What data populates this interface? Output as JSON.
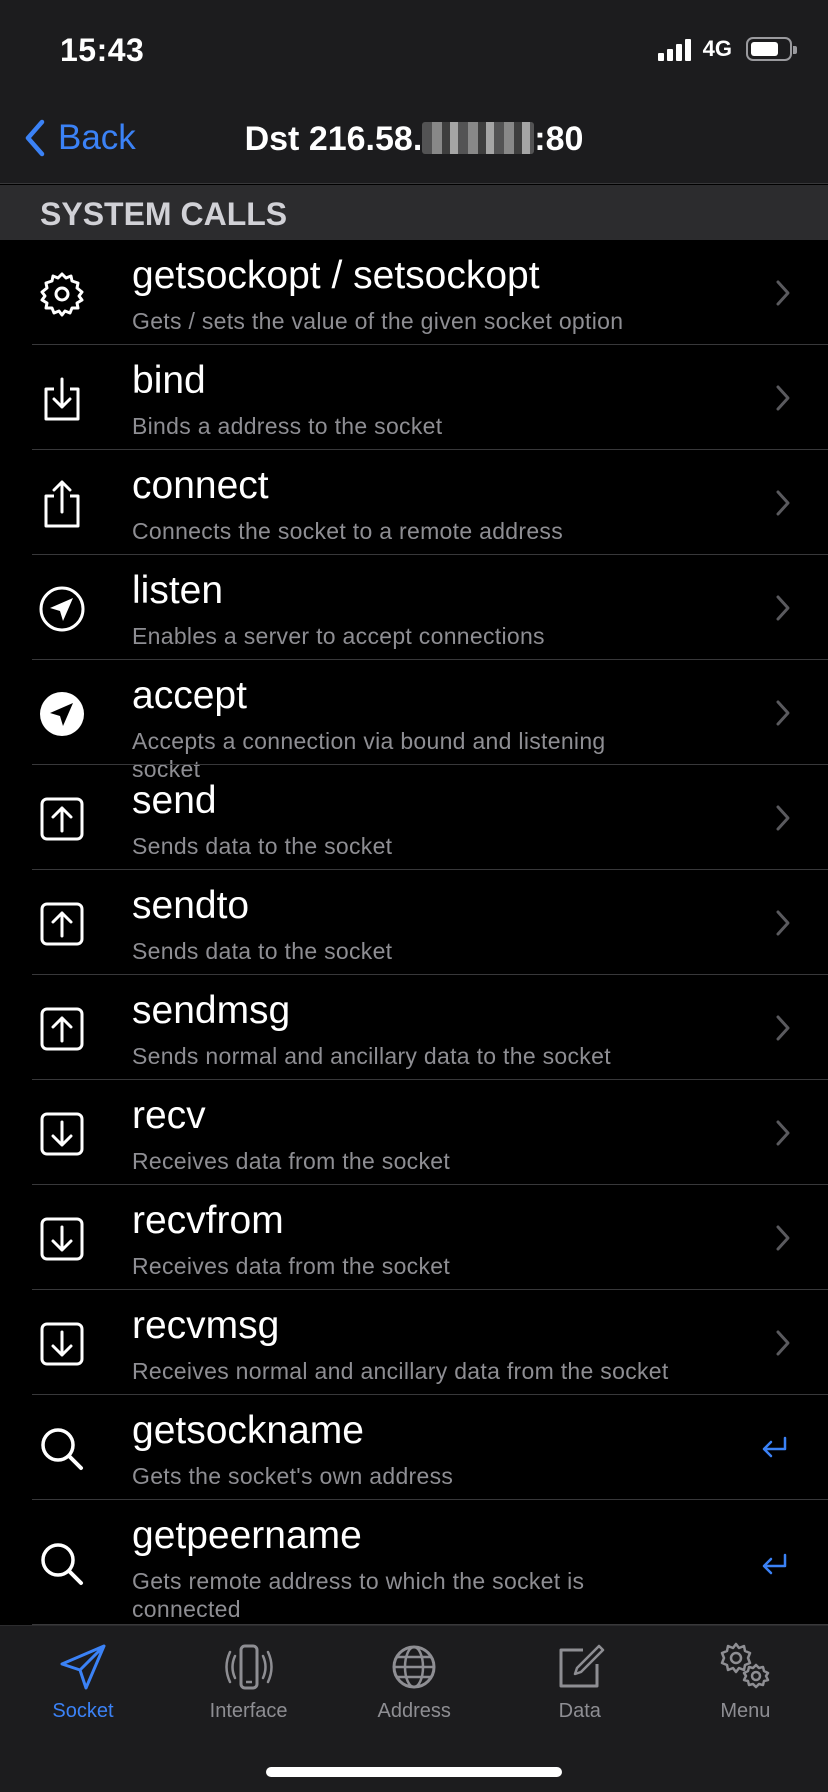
{
  "status": {
    "time": "15:43",
    "network": "4G",
    "battery_level": 0.7
  },
  "nav": {
    "back_label": "Back",
    "title_prefix": "Dst 216.58.",
    "title_suffix": ":80"
  },
  "section": {
    "title": "SYSTEM CALLS"
  },
  "calls": [
    {
      "name": "getsockopt / setsockopt",
      "desc": "Gets / sets the value of the given socket option",
      "icon": "gear-icon",
      "accessory": "chevron"
    },
    {
      "name": "bind",
      "desc": "Binds a address to the socket",
      "icon": "tray-arrow-down-icon",
      "accessory": "chevron"
    },
    {
      "name": "connect",
      "desc": "Connects the socket to a remote address",
      "icon": "share-icon",
      "accessory": "chevron"
    },
    {
      "name": "listen",
      "desc": "Enables a server to accept connections",
      "icon": "location-circle-outline-icon",
      "accessory": "chevron"
    },
    {
      "name": "accept",
      "desc": "Accepts a connection via bound and listening socket",
      "icon": "location-circle-fill-icon",
      "accessory": "chevron"
    },
    {
      "name": "send",
      "desc": "Sends data to the socket",
      "icon": "arrow-up-square-icon",
      "accessory": "chevron"
    },
    {
      "name": "sendto",
      "desc": "Sends data to the socket",
      "icon": "arrow-up-square-icon",
      "accessory": "chevron"
    },
    {
      "name": "sendmsg",
      "desc": "Sends normal and ancillary data to the socket",
      "icon": "arrow-up-square-icon",
      "accessory": "chevron"
    },
    {
      "name": "recv",
      "desc": "Receives data from the socket",
      "icon": "arrow-down-square-icon",
      "accessory": "chevron"
    },
    {
      "name": "recvfrom",
      "desc": "Receives data from the socket",
      "icon": "arrow-down-square-icon",
      "accessory": "chevron"
    },
    {
      "name": "recvmsg",
      "desc": "Receives normal and ancillary data from the socket",
      "icon": "arrow-down-square-icon",
      "accessory": "chevron"
    },
    {
      "name": "getsockname",
      "desc": "Gets the socket's own address",
      "icon": "magnifier-icon",
      "accessory": "return"
    },
    {
      "name": "getpeername",
      "desc": "Gets remote address to which the socket is connected",
      "icon": "magnifier-icon",
      "accessory": "return"
    }
  ],
  "tabs": [
    {
      "label": "Socket",
      "icon": "paperplane-icon",
      "active": true
    },
    {
      "label": "Interface",
      "icon": "phone-waves-icon",
      "active": false
    },
    {
      "label": "Address",
      "icon": "globe-icon",
      "active": false
    },
    {
      "label": "Data",
      "icon": "compose-icon",
      "active": false
    },
    {
      "label": "Menu",
      "icon": "gears-icon",
      "active": false
    }
  ],
  "colors": {
    "accent": "#3b82f6",
    "background": "#000000",
    "bar": "#1c1c1e",
    "section": "#2c2c2e",
    "secondary_text": "#8e8e93",
    "separator": "#38383a"
  }
}
